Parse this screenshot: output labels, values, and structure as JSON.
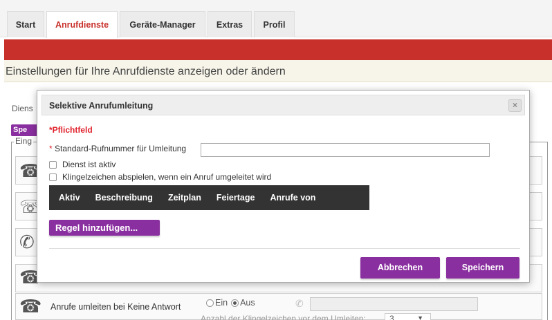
{
  "tabs": [
    {
      "label": "Start",
      "active": false
    },
    {
      "label": "Anrufdienste",
      "active": true
    },
    {
      "label": "Geräte-Manager",
      "active": false
    },
    {
      "label": "Extras",
      "active": false
    },
    {
      "label": "Profil",
      "active": false
    }
  ],
  "infobar": {
    "text": "Einstellungen für Ihre Anrufdienste anzeigen oder ändern"
  },
  "background": {
    "dienst_label": "Diens",
    "spe_button": "Spe",
    "eing_legend": "Eing",
    "row_text": "Anrufe umleiten bei Keine Antwort",
    "radio_on": "Ein",
    "radio_off": "Aus",
    "ring_count_label": "Anzahl der Klingelzeichen vor dem Umleiten:",
    "ring_count_value": "3"
  },
  "modal": {
    "title": "Selektive Anrufumleitung",
    "close": "×",
    "required_note": "*Pflichtfeld",
    "field_label_star": "*",
    "field_label": "Standard-Rufnummer für Umleitung",
    "field_value": "",
    "checkbox_active": "Dienst ist aktiv",
    "checkbox_ring": "Klingelzeichen abspielen, wenn ein Anruf umgeleitet wird",
    "table_columns": [
      "Aktiv",
      "Beschreibung",
      "Zeitplan",
      "Feiertage",
      "Anrufe von"
    ],
    "add_rule": "Regel hinzufügen...",
    "cancel": "Abbrechen",
    "save": "Speichern"
  },
  "colors": {
    "accent_red": "#c8312b",
    "purple": "#8a2fa0",
    "table_header": "#333333"
  }
}
